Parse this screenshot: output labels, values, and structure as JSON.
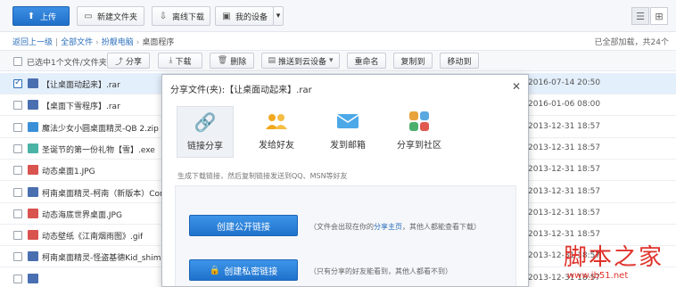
{
  "toolbar": {
    "upload_label": "上传",
    "new_folder_label": "新建文件夹",
    "offline_download_label": "离线下载",
    "my_device_label": "我的设备"
  },
  "breadcrumb": {
    "back": "返回上一级",
    "all_files": "全部文件",
    "folder": "扮靓电脑",
    "current": "桌面程序"
  },
  "loaded_status": "已全部加载，共24个",
  "actionbar": {
    "selection": "已选中1个文件/文件夹",
    "share": "分享",
    "download": "下载",
    "delete": "删除",
    "push_cloud": "推送到云设备",
    "rename": "重命名",
    "copy_to": "复制到",
    "move_to": "移动到"
  },
  "files": [
    {
      "name": "【让桌面动起来】.rar",
      "date": "2016-07-14 20:50",
      "selected": true,
      "icon": "rar-icon",
      "color": "#4a6fb0"
    },
    {
      "name": "【桌面下雪程序】.rar",
      "date": "2016-01-06 08:00",
      "selected": false,
      "icon": "rar-icon",
      "color": "#4a6fb0"
    },
    {
      "name": "魔法少女小圆桌面精灵-QB 2.zip",
      "date": "2013-12-31 18:57",
      "selected": false,
      "icon": "zip-icon",
      "color": "#3a8fd8"
    },
    {
      "name": "圣诞节的第一份礼物【雪】.exe",
      "date": "2013-12-31 18:57",
      "selected": false,
      "icon": "exe-icon",
      "color": "#4bb2a6"
    },
    {
      "name": "动态桌面1.JPG",
      "date": "2013-12-31 18:57",
      "selected": false,
      "icon": "image-icon",
      "color": "#d9534f"
    },
    {
      "name": "柯南桌面精灵-柯南（新版本）Conan_s",
      "date": "2013-12-31 18:57",
      "selected": false,
      "icon": "rar-icon",
      "color": "#4a6fb0"
    },
    {
      "name": "动态海底世界桌面.JPG",
      "date": "2013-12-31 18:57",
      "selected": false,
      "icon": "image-icon",
      "color": "#d9534f"
    },
    {
      "name": "动态壁纸《江南烟雨图》.gif",
      "date": "2013-12-31 18:57",
      "selected": false,
      "icon": "image-icon",
      "color": "#d9534f"
    },
    {
      "name": "柯南桌面精灵-怪盗基德Kid_shimeji.rar",
      "date": "2013-12-31 18:57",
      "selected": false,
      "icon": "rar-icon",
      "color": "#4a6fb0"
    },
    {
      "name": "",
      "date": "2013-12-31 18:57",
      "selected": false,
      "icon": "rar-icon",
      "color": "#4a6fb0"
    }
  ],
  "modal": {
    "title": "分享文件(夹):【让桌面动起来】.rar",
    "tabs": [
      {
        "label": "链接分享",
        "icon": "link-icon"
      },
      {
        "label": "发给好友",
        "icon": "friends-icon"
      },
      {
        "label": "发到邮箱",
        "icon": "mail-icon"
      },
      {
        "label": "分享到社区",
        "icon": "community-icon"
      }
    ],
    "description": "生成下载链接，然后复制链接发送到QQ、MSN等好友",
    "public_link_label": "创建公开链接",
    "public_hint_before": "（文件会出现在你的",
    "public_hint_link": "分享主页",
    "public_hint_after": "，其他人都能查看下载）",
    "private_link_label": "创建私密链接",
    "private_hint": "（只有分享的好友能看到，其他人都看不到）"
  },
  "watermark": {
    "big": "脚本之家",
    "url": "www.jb51.net"
  }
}
